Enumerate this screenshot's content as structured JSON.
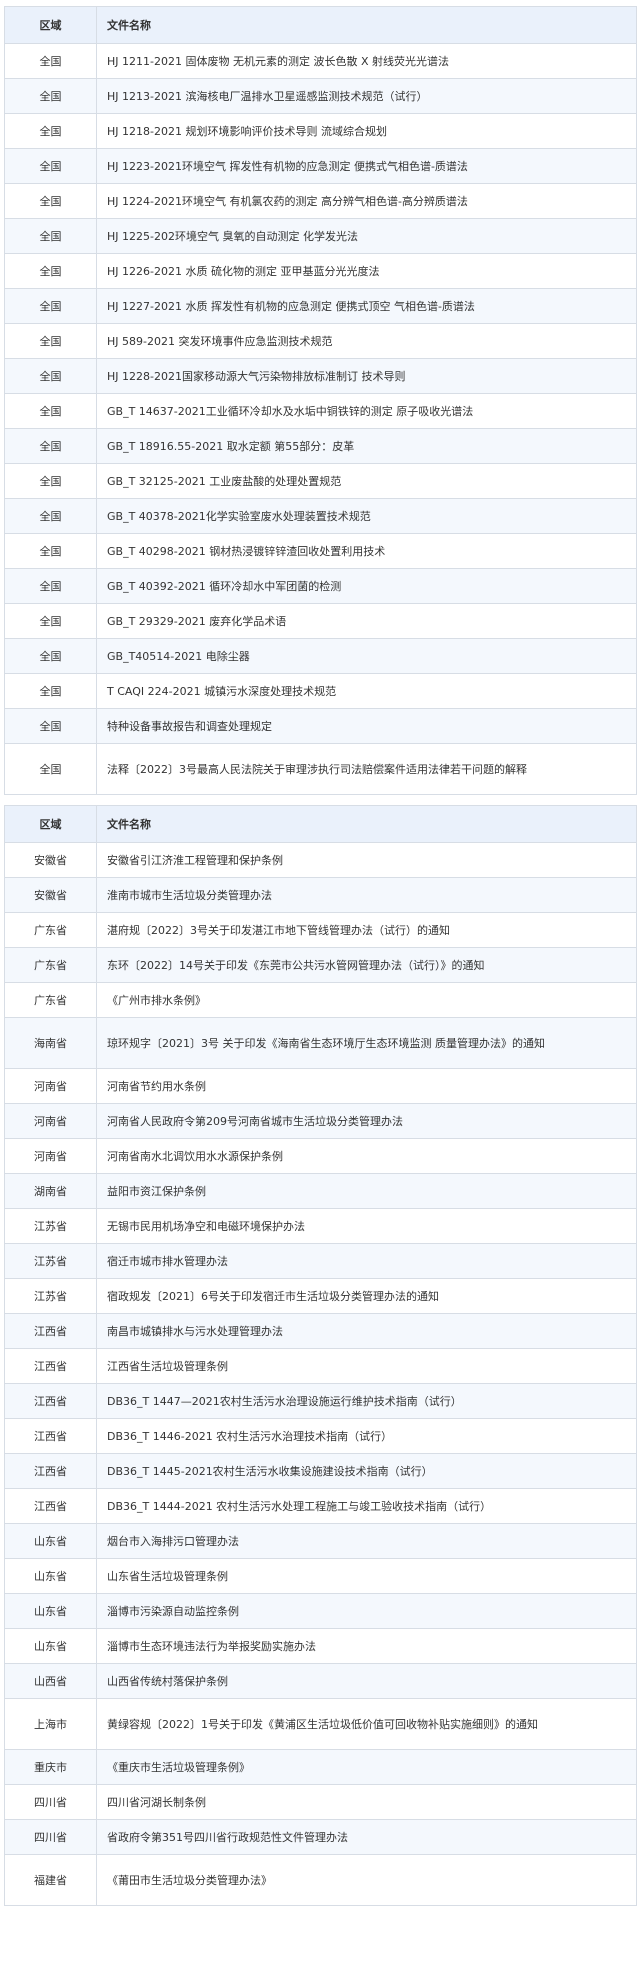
{
  "national_table": {
    "header": {
      "region": "区域",
      "name": "文件名称"
    },
    "rows": [
      {
        "region": "全国",
        "name": "HJ 1211-2021 固体废物 无机元素的测定 波长色散 X 射线荧光光谱法"
      },
      {
        "region": "全国",
        "name": "HJ 1213-2021 滨海核电厂温排水卫星遥感监测技术规范（试行）"
      },
      {
        "region": "全国",
        "name": "HJ 1218-2021 规划环境影响评价技术导则 流域综合规划"
      },
      {
        "region": "全国",
        "name": "HJ 1223-2021环境空气 挥发性有机物的应急测定 便携式气相色谱-质谱法"
      },
      {
        "region": "全国",
        "name": "HJ 1224-2021环境空气 有机氯农药的测定 高分辨气相色谱-高分辨质谱法"
      },
      {
        "region": "全国",
        "name": "HJ 1225-202环境空气 臭氧的自动测定 化学发光法"
      },
      {
        "region": "全国",
        "name": "HJ 1226-2021 水质 硫化物的测定 亚甲基蓝分光光度法"
      },
      {
        "region": "全国",
        "name": "HJ 1227-2021 水质 挥发性有机物的应急测定 便携式顶空 气相色谱-质谱法"
      },
      {
        "region": "全国",
        "name": "HJ 589-2021 突发环境事件应急监测技术规范"
      },
      {
        "region": "全国",
        "name": "HJ 1228-2021国家移动源大气污染物排放标准制订 技术导则"
      },
      {
        "region": "全国",
        "name": "GB_T 14637-2021工业循环冷却水及水垢中铜铁锌的测定 原子吸收光谱法"
      },
      {
        "region": "全国",
        "name": "GB_T 18916.55-2021 取水定额 第55部分：皮革"
      },
      {
        "region": "全国",
        "name": "GB_T 32125-2021 工业废盐酸的处理处置规范"
      },
      {
        "region": "全国",
        "name": "GB_T 40378-2021化学实验室废水处理装置技术规范"
      },
      {
        "region": "全国",
        "name": "GB_T 40298-2021 钢材热浸镀锌锌渣回收处置利用技术"
      },
      {
        "region": "全国",
        "name": "GB_T 40392-2021 循环冷却水中军团菌的检测"
      },
      {
        "region": "全国",
        "name": "GB_T 29329-2021 废弃化学品术语"
      },
      {
        "region": "全国",
        "name": "GB_T40514-2021 电除尘器"
      },
      {
        "region": "全国",
        "name": "T CAQI 224-2021 城镇污水深度处理技术规范"
      },
      {
        "region": "全国",
        "name": "特种设备事故报告和调查处理规定"
      },
      {
        "region": "全国",
        "name": "法释〔2022〕3号最高人民法院关于审理涉执行司法赔偿案件适用法律若干问题的解释",
        "tall": true
      }
    ]
  },
  "provincial_table": {
    "header": {
      "region": "区域",
      "name": "文件名称"
    },
    "rows": [
      {
        "region": "安徽省",
        "name": "安徽省引江济淮工程管理和保护条例"
      },
      {
        "region": "安徽省",
        "name": "淮南市城市生活垃圾分类管理办法"
      },
      {
        "region": "广东省",
        "name": "湛府规〔2022〕3号关于印发湛江市地下管线管理办法（试行）的通知"
      },
      {
        "region": "广东省",
        "name": "东环〔2022〕14号关于印发《东莞市公共污水管网管理办法（试行）》的通知"
      },
      {
        "region": "广东省",
        "name": "《广州市排水条例》"
      },
      {
        "region": "海南省",
        "name": "琼环规字〔2021〕3号 关于印发《海南省生态环境厅生态环境监测 质量管理办法》的通知",
        "tall": true
      },
      {
        "region": "河南省",
        "name": "河南省节约用水条例"
      },
      {
        "region": "河南省",
        "name": "河南省人民政府令第209号河南省城市生活垃圾分类管理办法"
      },
      {
        "region": "河南省",
        "name": "河南省南水北调饮用水水源保护条例"
      },
      {
        "region": "湖南省",
        "name": "益阳市资江保护条例"
      },
      {
        "region": "江苏省",
        "name": "无锡市民用机场净空和电磁环境保护办法"
      },
      {
        "region": "江苏省",
        "name": "宿迁市城市排水管理办法"
      },
      {
        "region": "江苏省",
        "name": "宿政规发〔2021〕6号关于印发宿迁市生活垃圾分类管理办法的通知"
      },
      {
        "region": "江西省",
        "name": "南昌市城镇排水与污水处理管理办法"
      },
      {
        "region": "江西省",
        "name": "江西省生活垃圾管理条例"
      },
      {
        "region": "江西省",
        "name": "DB36_T 1447—2021农村生活污水治理设施运行维护技术指南（试行）"
      },
      {
        "region": "江西省",
        "name": "DB36_T 1446-2021 农村生活污水治理技术指南（试行）"
      },
      {
        "region": "江西省",
        "name": "DB36_T 1445-2021农村生活污水收集设施建设技术指南（试行）"
      },
      {
        "region": "江西省",
        "name": "DB36_T 1444-2021 农村生活污水处理工程施工与竣工验收技术指南（试行）"
      },
      {
        "region": "山东省",
        "name": "烟台市入海排污口管理办法"
      },
      {
        "region": "山东省",
        "name": "山东省生活垃圾管理条例"
      },
      {
        "region": "山东省",
        "name": "淄博市污染源自动监控条例"
      },
      {
        "region": "山东省",
        "name": "淄博市生态环境违法行为举报奖励实施办法"
      },
      {
        "region": "山西省",
        "name": "山西省传统村落保护条例"
      },
      {
        "region": "上海市",
        "name": "黄绿容规〔2022〕1号关于印发《黄浦区生活垃圾低价值可回收物补贴实施细则》的通知",
        "tall": true
      },
      {
        "region": "重庆市",
        "name": "《重庆市生活垃圾管理条例》"
      },
      {
        "region": "四川省",
        "name": "四川省河湖长制条例"
      },
      {
        "region": "四川省",
        "name": "省政府令第351号四川省行政规范性文件管理办法"
      },
      {
        "region": "福建省",
        "name": "《莆田市生活垃圾分类管理办法》",
        "tall": true
      }
    ]
  }
}
